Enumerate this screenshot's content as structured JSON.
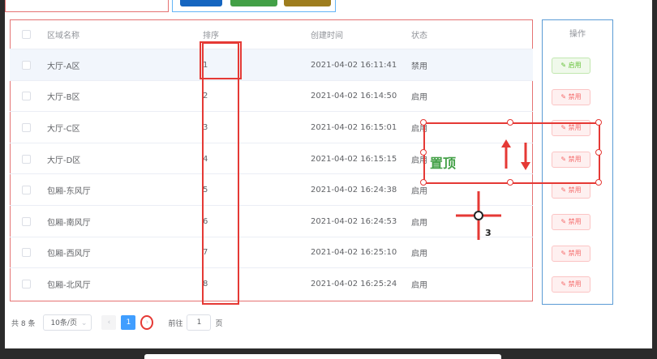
{
  "table": {
    "headers": {
      "name": "区域名称",
      "sort": "排序",
      "created": "创建时间",
      "status": "状态",
      "ops": "操作"
    },
    "rows": [
      {
        "name": "大厅-A区",
        "sort": "1",
        "created": "2021-04-02 16:11:41",
        "status": "禁用",
        "op": "启用"
      },
      {
        "name": "大厅-B区",
        "sort": "2",
        "created": "2021-04-02 16:14:50",
        "status": "启用",
        "op": "禁用"
      },
      {
        "name": "大厅-C区",
        "sort": "3",
        "created": "2021-04-02 16:15:01",
        "status": "启用",
        "op": "禁用"
      },
      {
        "name": "大厅-D区",
        "sort": "4",
        "created": "2021-04-02 16:15:15",
        "status": "启用",
        "op": "禁用"
      },
      {
        "name": "包厢-东风厅",
        "sort": "5",
        "created": "2021-04-02 16:24:38",
        "status": "启用",
        "op": "禁用"
      },
      {
        "name": "包厢-南风厅",
        "sort": "6",
        "created": "2021-04-02 16:24:53",
        "status": "启用",
        "op": "禁用"
      },
      {
        "name": "包厢-西风厅",
        "sort": "7",
        "created": "2021-04-02 16:25:10",
        "status": "启用",
        "op": "禁用"
      },
      {
        "name": "包厢-北风厅",
        "sort": "8",
        "created": "2021-04-02 16:25:24",
        "status": "启用",
        "op": "禁用"
      }
    ]
  },
  "pagination": {
    "total": "共 8 条",
    "page_size": "10条/页",
    "prev": "‹",
    "current": "1",
    "next": "›",
    "goto_prefix": "前往",
    "goto_value": "1",
    "goto_suffix": "页"
  },
  "annotation": {
    "pin_label": "置顶",
    "marker_number": "3"
  },
  "colors": {
    "annotation_red": "#e53935",
    "primary": "#409eff",
    "success": "#67c23a",
    "danger": "#f56c6c"
  }
}
